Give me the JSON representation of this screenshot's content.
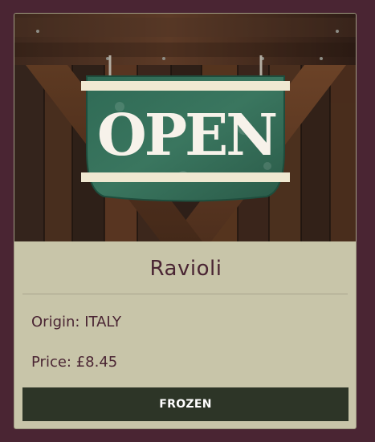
{
  "product": {
    "name": "Ravioli",
    "origin_label": "Origin:",
    "origin_value": "ITALY",
    "price_label": "Price:",
    "price_value": "£8.45",
    "button_label": "FROZEN"
  },
  "image": {
    "sign_text": "OPEN"
  },
  "colors": {
    "page_background": "#4a2533",
    "card_background": "#c8c5a9",
    "button_background": "#2d3527",
    "text": "#4a2533",
    "button_text": "#ffffff"
  }
}
